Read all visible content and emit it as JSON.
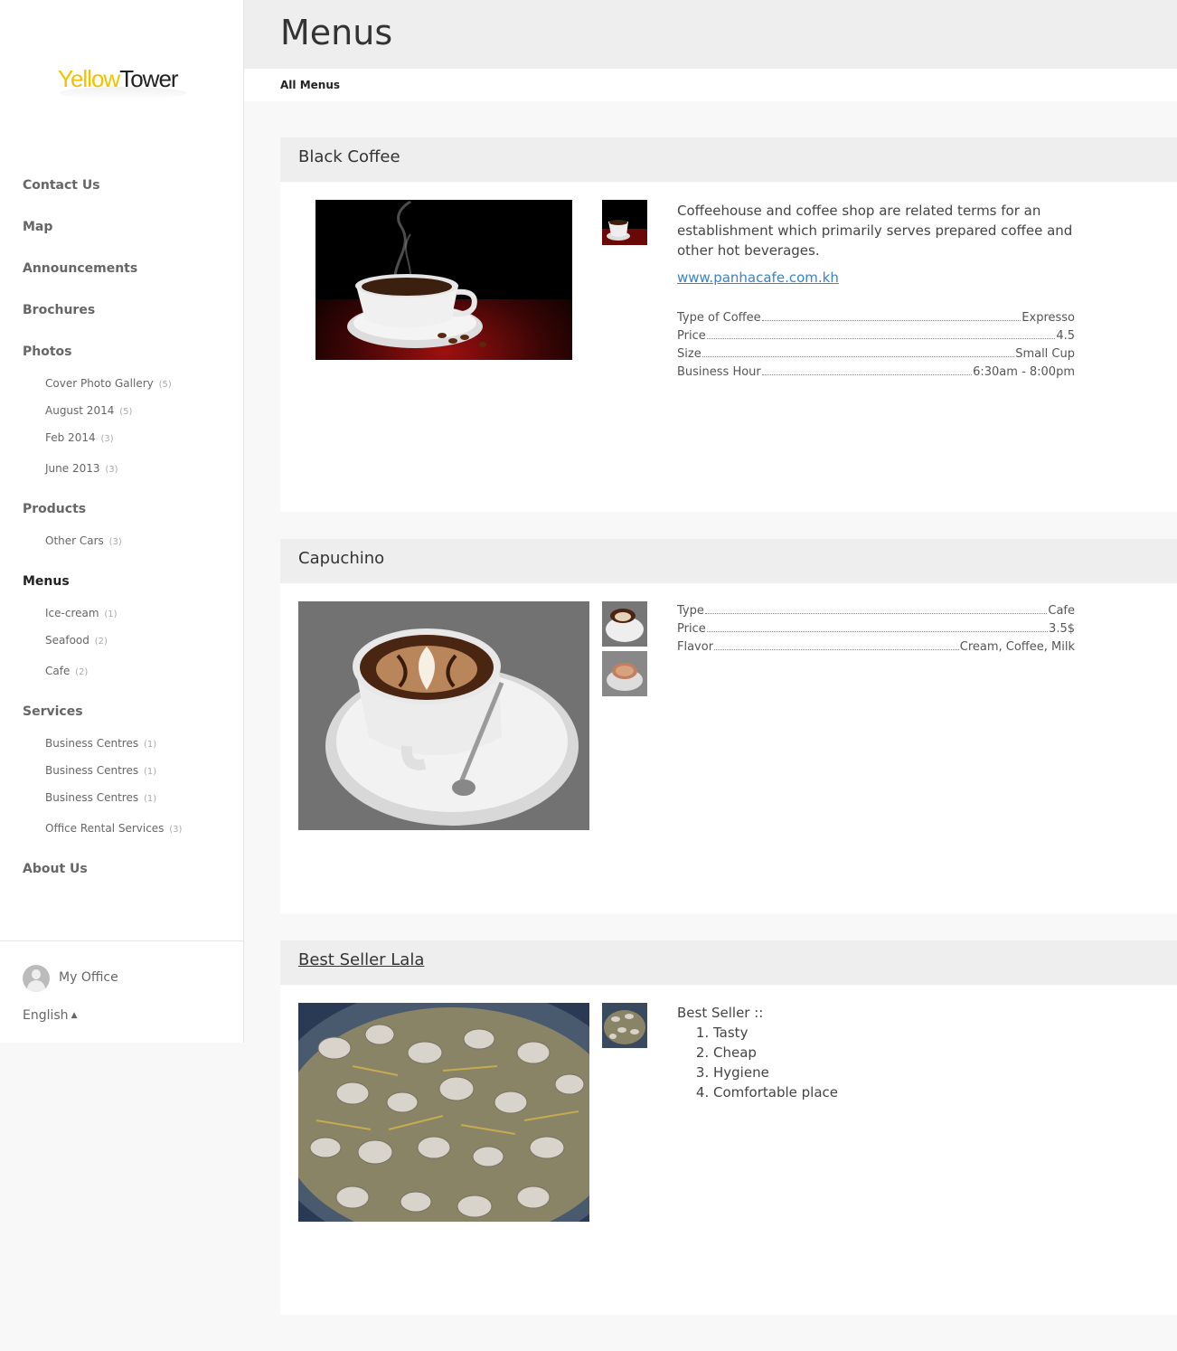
{
  "brand": {
    "logo_yellow": "Yellow",
    "logo_dark": "Tower"
  },
  "sidebar": {
    "items": [
      {
        "label": "Contact Us"
      },
      {
        "label": "Map"
      },
      {
        "label": "Announcements"
      },
      {
        "label": "Brochures"
      },
      {
        "label": "Photos",
        "children": [
          {
            "label": "Cover Photo Gallery",
            "count": "(5)"
          },
          {
            "label": "August 2014",
            "count": "(5)"
          },
          {
            "label": "Feb 2014",
            "count": "(3)"
          },
          {
            "label": "June 2013",
            "count": "(3)"
          }
        ]
      },
      {
        "label": "Products",
        "children": [
          {
            "label": "Other Cars",
            "count": "(3)"
          }
        ]
      },
      {
        "label": "Menus",
        "children": [
          {
            "label": "Ice-cream",
            "count": "(1)"
          },
          {
            "label": "Seafood",
            "count": "(2)"
          },
          {
            "label": "Cafe",
            "count": "(2)"
          }
        ]
      },
      {
        "label": "Services",
        "children": [
          {
            "label": "Business Centres",
            "count": "(1)"
          },
          {
            "label": "Business Centres",
            "count": "(1)"
          },
          {
            "label": "Business Centres",
            "count": "(1)"
          },
          {
            "label": "Office Rental Services",
            "count": "(3)"
          }
        ]
      },
      {
        "label": "About Us"
      }
    ],
    "footer": {
      "user_label": "My Office",
      "language": "English",
      "language_caret": "▲"
    }
  },
  "header": {
    "title": "Menus"
  },
  "breadcrumb": {
    "label": "All Menus"
  },
  "menus": [
    {
      "title": "Black Coffee",
      "description": "Coffeehouse and coffee shop are related terms for an establishment which primarily serves prepared coffee and other hot beverages.",
      "link": "www.panhacafe.com.kh",
      "specs": [
        {
          "key": "Type of Coffee",
          "value": "Expresso"
        },
        {
          "key": "Price",
          "value": "4.5"
        },
        {
          "key": "Size",
          "value": "Small Cup"
        },
        {
          "key": "Business Hour",
          "value": "6:30am - 8:00pm"
        }
      ]
    },
    {
      "title": "Capuchino",
      "specs": [
        {
          "key": "Type",
          "value": "Cafe"
        },
        {
          "key": "Price",
          "value": "3.5$"
        },
        {
          "key": "Flavor",
          "value": "Cream, Coffee, Milk"
        }
      ]
    },
    {
      "title": "Best Seller Lala",
      "list_title": "Best Seller ::",
      "list": [
        "Tasty",
        "Cheap",
        "Hygiene",
        "Comfortable place"
      ]
    }
  ]
}
